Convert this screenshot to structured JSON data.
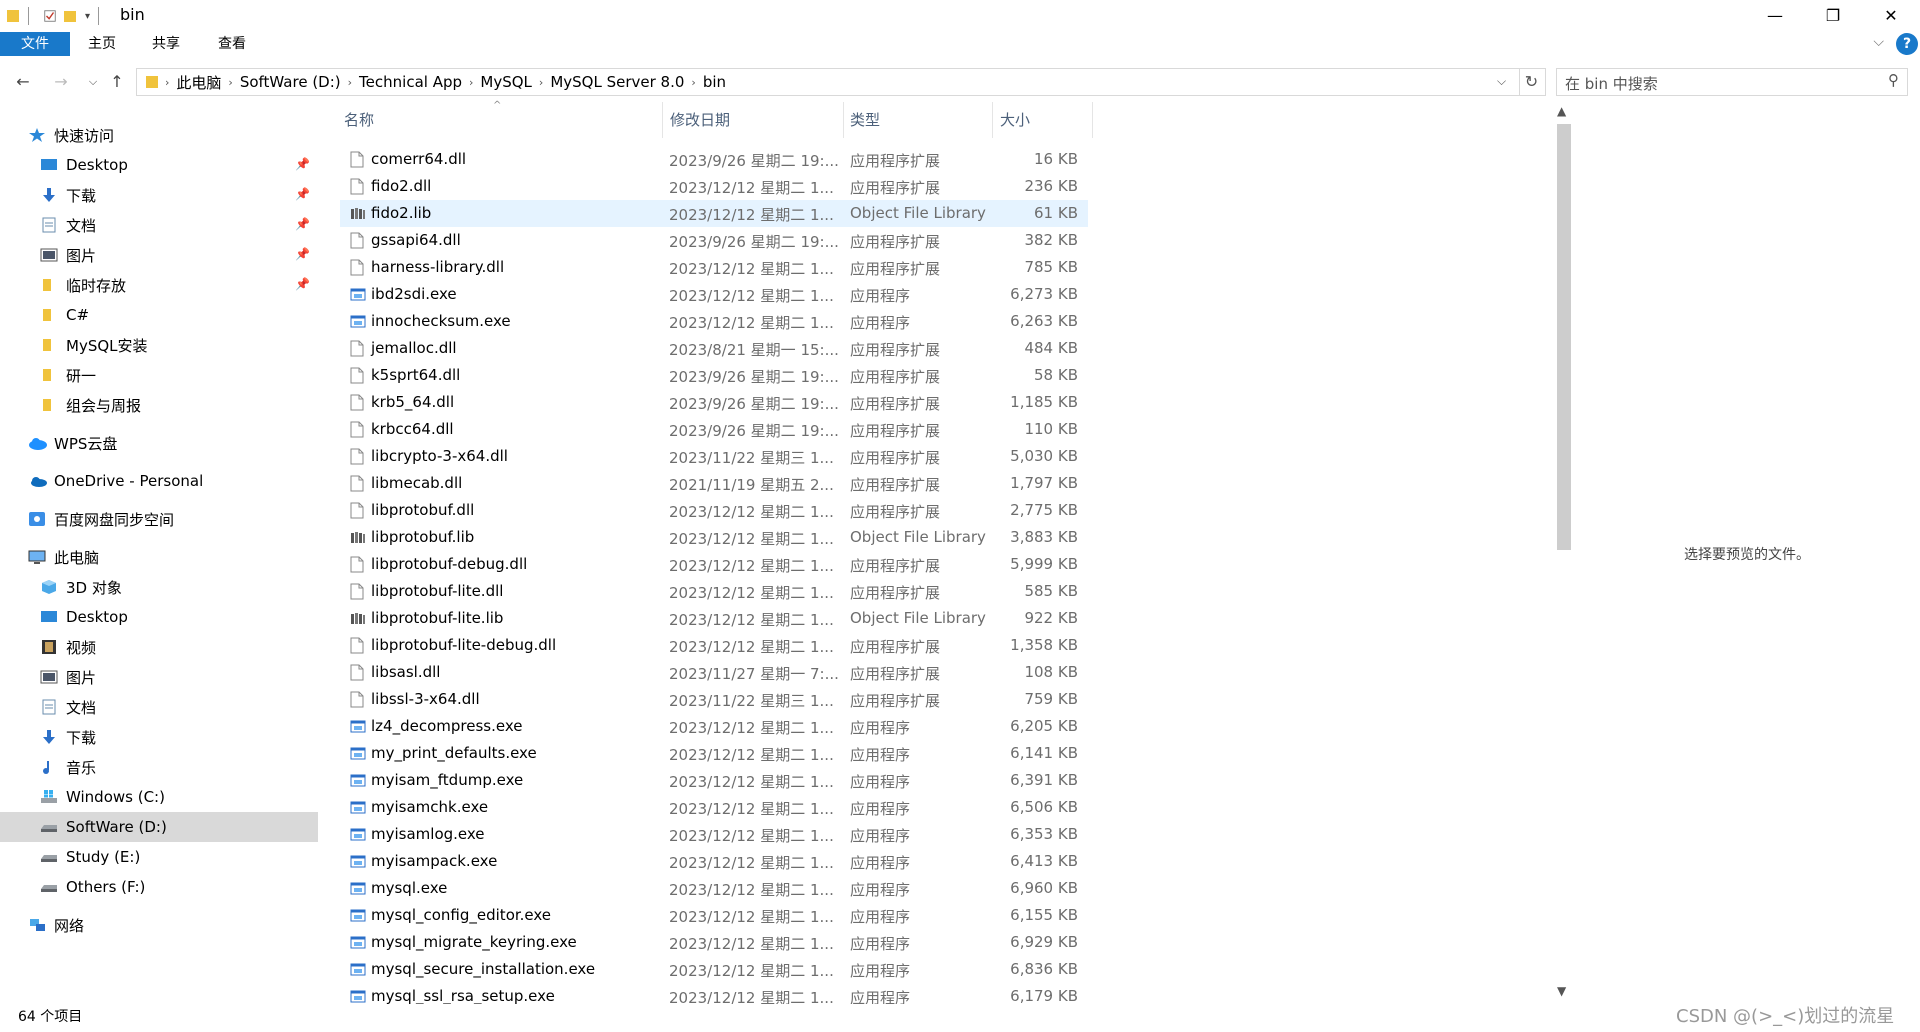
{
  "window": {
    "title": "bin",
    "min": "—",
    "max": "❐",
    "close": "✕"
  },
  "ribbon": {
    "tabs": [
      "文件",
      "主页",
      "共享",
      "查看"
    ],
    "help": "?"
  },
  "address": {
    "segments": [
      "此电脑",
      "SoftWare (D:)",
      "Technical App",
      "MySQL",
      "MySQL Server 8.0",
      "bin"
    ],
    "search_placeholder": "在 bin 中搜索"
  },
  "nav": [
    {
      "label": "快速访问",
      "icon": "star-icon",
      "level": 0,
      "pinned": false
    },
    {
      "label": "Desktop",
      "icon": "desktop-icon",
      "level": 1,
      "pinned": true
    },
    {
      "label": "下载",
      "icon": "download-icon",
      "level": 1,
      "pinned": true
    },
    {
      "label": "文档",
      "icon": "document-icon",
      "level": 1,
      "pinned": true
    },
    {
      "label": "图片",
      "icon": "picture-icon",
      "level": 1,
      "pinned": true
    },
    {
      "label": "临时存放",
      "icon": "folder-icon",
      "level": 1,
      "pinned": true
    },
    {
      "label": "C#",
      "icon": "folder-icon",
      "level": 1,
      "pinned": false
    },
    {
      "label": "MySQL安装",
      "icon": "folder-icon",
      "level": 1,
      "pinned": false
    },
    {
      "label": "研一",
      "icon": "folder-icon",
      "level": 1,
      "pinned": false
    },
    {
      "label": "组会与周报",
      "icon": "folder-icon",
      "level": 1,
      "pinned": false
    },
    {
      "label": "WPS云盘",
      "icon": "cloud-icon",
      "level": 0,
      "pinned": false
    },
    {
      "label": "OneDrive - Personal",
      "icon": "onedrive-icon",
      "level": 0,
      "pinned": false
    },
    {
      "label": "百度网盘同步空间",
      "icon": "baidu-icon",
      "level": 0,
      "pinned": false
    },
    {
      "label": "此电脑",
      "icon": "computer-icon",
      "level": 0,
      "pinned": false
    },
    {
      "label": "3D 对象",
      "icon": "cube-icon",
      "level": 1,
      "pinned": false
    },
    {
      "label": "Desktop",
      "icon": "desktop-icon",
      "level": 1,
      "pinned": false
    },
    {
      "label": "视频",
      "icon": "video-icon",
      "level": 1,
      "pinned": false
    },
    {
      "label": "图片",
      "icon": "picture-icon",
      "level": 1,
      "pinned": false
    },
    {
      "label": "文档",
      "icon": "document-icon",
      "level": 1,
      "pinned": false
    },
    {
      "label": "下载",
      "icon": "download-icon",
      "level": 1,
      "pinned": false
    },
    {
      "label": "音乐",
      "icon": "music-icon",
      "level": 1,
      "pinned": false
    },
    {
      "label": "Windows (C:)",
      "icon": "windows-drive-icon",
      "level": 1,
      "pinned": false
    },
    {
      "label": "SoftWare (D:)",
      "icon": "drive-icon",
      "level": 1,
      "pinned": false,
      "selected": true
    },
    {
      "label": "Study (E:)",
      "icon": "drive-icon",
      "level": 1,
      "pinned": false
    },
    {
      "label": "Others (F:)",
      "icon": "drive-icon",
      "level": 1,
      "pinned": false
    },
    {
      "label": "网络",
      "icon": "network-icon",
      "level": 0,
      "pinned": false
    }
  ],
  "columns": {
    "name": "名称",
    "date": "修改日期",
    "type": "类型",
    "size": "大小"
  },
  "files": [
    {
      "name": "comerr64.dll",
      "date": "2023/9/26 星期二 19:...",
      "type": "应用程序扩展",
      "size": "16 KB",
      "kind": "dll"
    },
    {
      "name": "fido2.dll",
      "date": "2023/12/12 星期二 1...",
      "type": "应用程序扩展",
      "size": "236 KB",
      "kind": "dll"
    },
    {
      "name": "fido2.lib",
      "date": "2023/12/12 星期二 1...",
      "type": "Object File Library",
      "size": "61 KB",
      "kind": "lib",
      "selected": true
    },
    {
      "name": "gssapi64.dll",
      "date": "2023/9/26 星期二 19:...",
      "type": "应用程序扩展",
      "size": "382 KB",
      "kind": "dll"
    },
    {
      "name": "harness-library.dll",
      "date": "2023/12/12 星期二 1...",
      "type": "应用程序扩展",
      "size": "785 KB",
      "kind": "dll"
    },
    {
      "name": "ibd2sdi.exe",
      "date": "2023/12/12 星期二 1...",
      "type": "应用程序",
      "size": "6,273 KB",
      "kind": "exe"
    },
    {
      "name": "innochecksum.exe",
      "date": "2023/12/12 星期二 1...",
      "type": "应用程序",
      "size": "6,263 KB",
      "kind": "exe"
    },
    {
      "name": "jemalloc.dll",
      "date": "2023/8/21 星期一 15:...",
      "type": "应用程序扩展",
      "size": "484 KB",
      "kind": "dll"
    },
    {
      "name": "k5sprt64.dll",
      "date": "2023/9/26 星期二 19:...",
      "type": "应用程序扩展",
      "size": "58 KB",
      "kind": "dll"
    },
    {
      "name": "krb5_64.dll",
      "date": "2023/9/26 星期二 19:...",
      "type": "应用程序扩展",
      "size": "1,185 KB",
      "kind": "dll"
    },
    {
      "name": "krbcc64.dll",
      "date": "2023/9/26 星期二 19:...",
      "type": "应用程序扩展",
      "size": "110 KB",
      "kind": "dll"
    },
    {
      "name": "libcrypto-3-x64.dll",
      "date": "2023/11/22 星期三 1...",
      "type": "应用程序扩展",
      "size": "5,030 KB",
      "kind": "dll"
    },
    {
      "name": "libmecab.dll",
      "date": "2021/11/19 星期五 2...",
      "type": "应用程序扩展",
      "size": "1,797 KB",
      "kind": "dll"
    },
    {
      "name": "libprotobuf.dll",
      "date": "2023/12/12 星期二 1...",
      "type": "应用程序扩展",
      "size": "2,775 KB",
      "kind": "dll"
    },
    {
      "name": "libprotobuf.lib",
      "date": "2023/12/12 星期二 1...",
      "type": "Object File Library",
      "size": "3,883 KB",
      "kind": "lib"
    },
    {
      "name": "libprotobuf-debug.dll",
      "date": "2023/12/12 星期二 1...",
      "type": "应用程序扩展",
      "size": "5,999 KB",
      "kind": "dll"
    },
    {
      "name": "libprotobuf-lite.dll",
      "date": "2023/12/12 星期二 1...",
      "type": "应用程序扩展",
      "size": "585 KB",
      "kind": "dll"
    },
    {
      "name": "libprotobuf-lite.lib",
      "date": "2023/12/12 星期二 1...",
      "type": "Object File Library",
      "size": "922 KB",
      "kind": "lib"
    },
    {
      "name": "libprotobuf-lite-debug.dll",
      "date": "2023/12/12 星期二 1...",
      "type": "应用程序扩展",
      "size": "1,358 KB",
      "kind": "dll"
    },
    {
      "name": "libsasl.dll",
      "date": "2023/11/27 星期一 7:...",
      "type": "应用程序扩展",
      "size": "108 KB",
      "kind": "dll"
    },
    {
      "name": "libssl-3-x64.dll",
      "date": "2023/11/22 星期三 1...",
      "type": "应用程序扩展",
      "size": "759 KB",
      "kind": "dll"
    },
    {
      "name": "lz4_decompress.exe",
      "date": "2023/12/12 星期二 1...",
      "type": "应用程序",
      "size": "6,205 KB",
      "kind": "exe"
    },
    {
      "name": "my_print_defaults.exe",
      "date": "2023/12/12 星期二 1...",
      "type": "应用程序",
      "size": "6,141 KB",
      "kind": "exe"
    },
    {
      "name": "myisam_ftdump.exe",
      "date": "2023/12/12 星期二 1...",
      "type": "应用程序",
      "size": "6,391 KB",
      "kind": "exe"
    },
    {
      "name": "myisamchk.exe",
      "date": "2023/12/12 星期二 1...",
      "type": "应用程序",
      "size": "6,506 KB",
      "kind": "exe"
    },
    {
      "name": "myisamlog.exe",
      "date": "2023/12/12 星期二 1...",
      "type": "应用程序",
      "size": "6,353 KB",
      "kind": "exe"
    },
    {
      "name": "myisampack.exe",
      "date": "2023/12/12 星期二 1...",
      "type": "应用程序",
      "size": "6,413 KB",
      "kind": "exe"
    },
    {
      "name": "mysql.exe",
      "date": "2023/12/12 星期二 1...",
      "type": "应用程序",
      "size": "6,960 KB",
      "kind": "exe"
    },
    {
      "name": "mysql_config_editor.exe",
      "date": "2023/12/12 星期二 1...",
      "type": "应用程序",
      "size": "6,155 KB",
      "kind": "exe"
    },
    {
      "name": "mysql_migrate_keyring.exe",
      "date": "2023/12/12 星期二 1...",
      "type": "应用程序",
      "size": "6,929 KB",
      "kind": "exe"
    },
    {
      "name": "mysql_secure_installation.exe",
      "date": "2023/12/12 星期二 1...",
      "type": "应用程序",
      "size": "6,836 KB",
      "kind": "exe"
    },
    {
      "name": "mysql_ssl_rsa_setup.exe",
      "date": "2023/12/12 星期二 1...",
      "type": "应用程序",
      "size": "6,179 KB",
      "kind": "exe"
    }
  ],
  "preview_text": "选择要预览的文件。",
  "status": "64 个项目",
  "watermark": "CSDN @(>_<)划过的流星",
  "colors": {
    "accent": "#1979ca",
    "selected_row": "#e5f3ff",
    "nav_selected": "#d9d9d9"
  }
}
